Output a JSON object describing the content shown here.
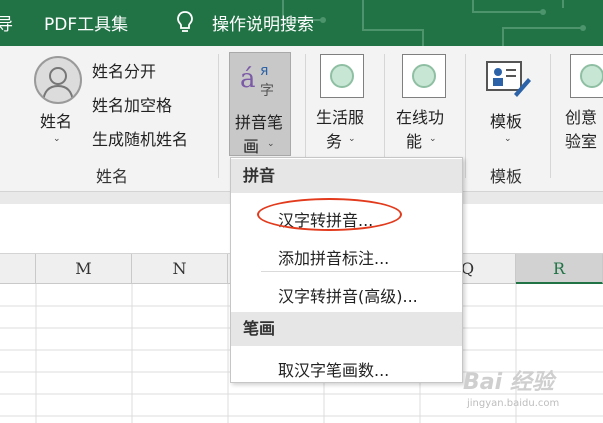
{
  "titlebar": {
    "partial_left": "导",
    "pdf_tools": "PDF工具集",
    "help_search": "操作说明搜索"
  },
  "ribbon": {
    "name_group": {
      "big_button": "姓名",
      "items": [
        "姓名分开",
        "姓名加空格",
        "生成随机姓名"
      ],
      "label": "姓名"
    },
    "pinyin_button": {
      "line1": "拼音笔",
      "line2": "画"
    },
    "life_service": {
      "line1": "生活服",
      "line2": "务"
    },
    "online_func": {
      "line1": "在线功",
      "line2": "能"
    },
    "template_button": "模板",
    "template_label": "模板",
    "creative": {
      "line1": "创意",
      "line2": "验室"
    }
  },
  "columns": [
    "M",
    "N",
    "",
    "",
    "Q",
    "R"
  ],
  "dropdown": {
    "section_pinyin": "拼音",
    "items_pinyin": [
      "汉字转拼音...",
      "添加拼音标注...",
      "汉字转拼音(高级)..."
    ],
    "section_stroke": "笔画",
    "items_stroke": [
      "取汉字笔画数..."
    ]
  },
  "watermark": {
    "main": "Bai 经验",
    "sub": "jingyan.baidu.com"
  },
  "colors": {
    "titlebar": "#217346",
    "highlight": "#e23a1c",
    "selected_col": "#217346"
  }
}
